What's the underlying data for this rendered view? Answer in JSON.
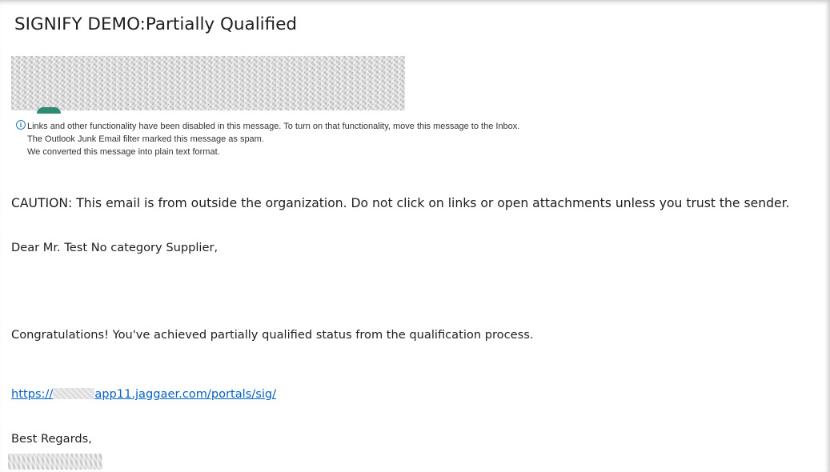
{
  "email": {
    "subject": "SIGNIFY DEMO:Partially Qualified",
    "info_icon": "info-circle-icon",
    "info_lines": [
      "Links and other functionality have been disabled in this message. To turn on that functionality, move this message to the Inbox.",
      "The Outlook Junk Email filter marked this message as spam.",
      "We converted this message into plain text format."
    ],
    "body": {
      "caution": "CAUTION: This email is from outside the organization. Do not click on links or open attachments unless you trust the sender.",
      "greeting": "Dear Mr. Test No category Supplier,",
      "congrats": "Congratulations! You've achieved partially qualified status from the qualification process.",
      "link_prefix": "https://",
      "link_suffix": "app11.jaggaer.com/portals/sig/",
      "regards": "Best Regards,"
    },
    "colors": {
      "link": "#0563c1",
      "info_icon": "#2b7bb9"
    }
  }
}
